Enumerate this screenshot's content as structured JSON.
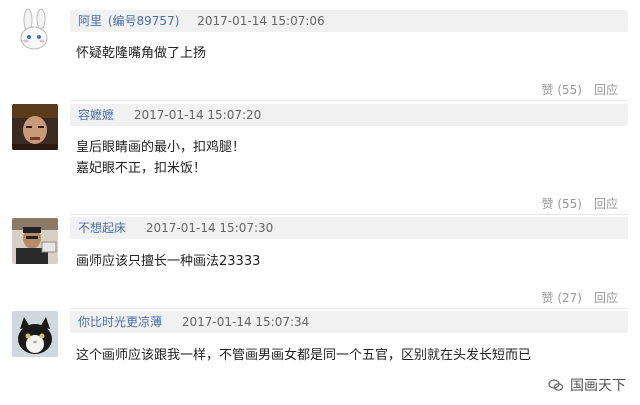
{
  "comments": [
    {
      "user": "阿里",
      "uid": "(编号89757)",
      "time": "2017-01-14 15:07:06",
      "lines": [
        "怀疑乾隆嘴角做了上扬"
      ],
      "like": "赞 (55)",
      "reply": "回应",
      "avatar": "bunny-avatar"
    },
    {
      "user": "容嬷嬷",
      "uid": "",
      "time": "2017-01-14 15:07:20",
      "lines": [
        "皇后眼睛画的最小，扣鸡腿！",
        "嘉妃眼不正，扣米饭！"
      ],
      "like": "赞 (55)",
      "reply": "回应",
      "avatar": "old-lady-avatar"
    },
    {
      "user": "不想起床",
      "uid": "",
      "time": "2017-01-14 15:07:30",
      "lines": [
        "画师应该只擅长一种画法23333"
      ],
      "like": "赞 (27)",
      "reply": "回应",
      "avatar": "man-avatar"
    },
    {
      "user": "你比时光更凉薄",
      "uid": "",
      "time": "2017-01-14 15:07:34",
      "lines": [
        "这个画师应该跟我一样，不管画男画女都是同一个五官，区别就在头发长短而已"
      ],
      "like": "赞 (53)",
      "reply": "回应",
      "avatar": "cat-avatar"
    }
  ],
  "watermark": "国画天下"
}
